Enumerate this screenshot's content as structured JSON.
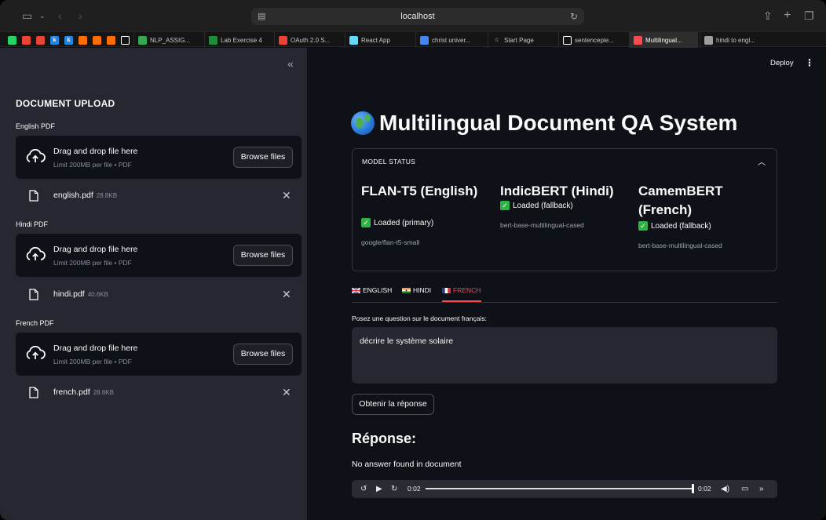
{
  "browser": {
    "url": "localhost",
    "tabs": [
      {
        "label": "",
        "icon": "whatsapp-icon",
        "color": "#25d366"
      },
      {
        "label": "",
        "icon": "google-icon",
        "color": "#ea4335"
      },
      {
        "label": "",
        "icon": "google-icon",
        "color": "#ea4335"
      },
      {
        "label": "k",
        "icon": "k-icon",
        "color": "#1e88e5"
      },
      {
        "label": "k",
        "icon": "k-icon",
        "color": "#1e88e5"
      },
      {
        "label": "",
        "icon": "orange-app-icon",
        "color": "#ff6d00"
      },
      {
        "label": "",
        "icon": "orange-app-icon",
        "color": "#ff6d00"
      },
      {
        "label": "",
        "icon": "orange-app-icon",
        "color": "#ff6d00"
      },
      {
        "label": "",
        "icon": "notion-icon",
        "color": "#ffffff"
      },
      {
        "label": "NLP_ASSIG...",
        "icon": "drive-icon",
        "color": "#34a853"
      },
      {
        "label": "Lab Exercise 4",
        "icon": "classroom-icon",
        "color": "#1e8e3e"
      },
      {
        "label": "OAuth 2.0 S...",
        "icon": "google-icon",
        "color": "#ea4335"
      },
      {
        "label": "React App",
        "icon": "react-icon",
        "color": "#61dafb"
      },
      {
        "label": "christ univer...",
        "icon": "calendar-icon",
        "color": "#4285f4"
      },
      {
        "label": "Start Page",
        "icon": "star-icon",
        "color": "#cccccc"
      },
      {
        "label": "sentencepie...",
        "icon": "github-icon",
        "color": "#ffffff"
      },
      {
        "label": "Multilingual...",
        "icon": "streamlit-icon",
        "color": "#ff4b4b"
      },
      {
        "label": "hindi to engl...",
        "icon": "g-translate-icon",
        "color": "#9e9e9e"
      }
    ]
  },
  "sidebar": {
    "title": "DOCUMENT UPLOAD",
    "uploads": [
      {
        "label": "English PDF",
        "drop_text": "Drag and drop file here",
        "limit_text": "Limit 200MB per file • PDF",
        "button": "Browse files",
        "file_name": "english.pdf",
        "file_size": "28.8KB"
      },
      {
        "label": "Hindi PDF",
        "drop_text": "Drag and drop file here",
        "limit_text": "Limit 200MB per file • PDF",
        "button": "Browse files",
        "file_name": "hindi.pdf",
        "file_size": "40.6KB"
      },
      {
        "label": "French PDF",
        "drop_text": "Drag and drop file here",
        "limit_text": "Limit 200MB per file • PDF",
        "button": "Browse files",
        "file_name": "french.pdf",
        "file_size": "28.8KB"
      }
    ]
  },
  "header": {
    "deploy": "Deploy",
    "menu": "⋮"
  },
  "main": {
    "title": "Multilingual Document QA System",
    "model_status": {
      "label": "MODEL STATUS",
      "models": [
        {
          "name": "FLAN-T5 (English)",
          "status": "Loaded (primary)",
          "model_id": "google/flan-t5-small"
        },
        {
          "name": "IndicBERT (Hindi)",
          "status": "Loaded (fallback)",
          "model_id": "bert-base-multilingual-cased"
        },
        {
          "name": "CamemBERT (French)",
          "status": "Loaded (fallback)",
          "model_id": "bert-base-multilingual-cased"
        }
      ]
    },
    "tabs": [
      {
        "label": "ENGLISH",
        "flag": "uk-flag-icon"
      },
      {
        "label": "HINDI",
        "flag": "india-flag-icon"
      },
      {
        "label": "FRENCH",
        "flag": "france-flag-icon"
      }
    ],
    "active_tab": "FRENCH",
    "question_label": "Posez une question sur le document français:",
    "question_value": "décrire le système solaire",
    "ask_button": "Obtenir la réponse",
    "answer_title": "Réponse:",
    "answer_text": "No answer found in document",
    "audio": {
      "current": "0:02",
      "duration": "0:02",
      "progress": 1.0
    }
  },
  "colors": {
    "accent": "#ff4b4b",
    "sidebar_bg": "#262730",
    "main_bg": "#0e1117",
    "loaded": "#2fb344"
  }
}
